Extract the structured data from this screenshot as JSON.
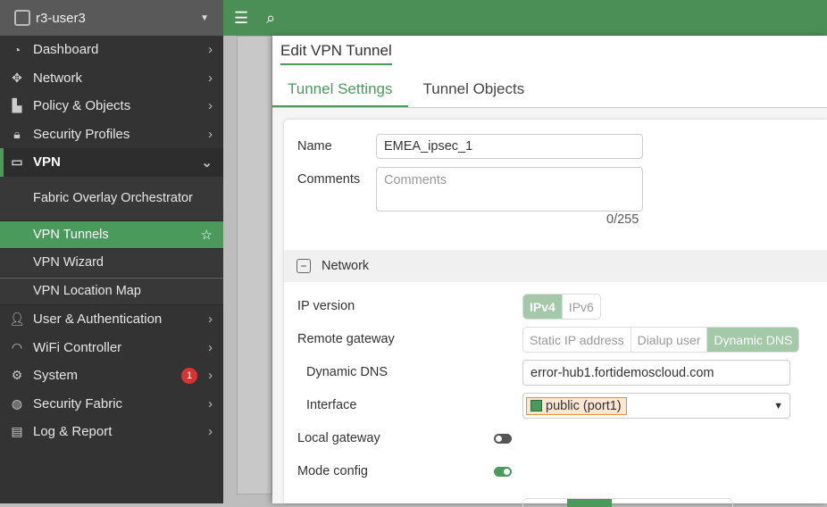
{
  "sidebar": {
    "device": "r3-user3",
    "items": [
      {
        "label": "Dashboard",
        "icon": "dashboard-icon"
      },
      {
        "label": "Network",
        "icon": "network-icon"
      },
      {
        "label": "Policy & Objects",
        "icon": "policy-icon"
      },
      {
        "label": "Security Profiles",
        "icon": "lock-icon"
      },
      {
        "label": "VPN",
        "icon": "laptop-icon"
      },
      {
        "label": "User & Authentication",
        "icon": "user-icon"
      },
      {
        "label": "WiFi Controller",
        "icon": "wifi-icon"
      },
      {
        "label": "System",
        "icon": "gear-icon",
        "badge": "1"
      },
      {
        "label": "Security Fabric",
        "icon": "fabric-icon"
      },
      {
        "label": "Log & Report",
        "icon": "chart-icon"
      }
    ],
    "vpn_sub": [
      "Fabric Overlay Orchestrator",
      "VPN Tunnels",
      "VPN Wizard",
      "VPN Location Map"
    ]
  },
  "modal": {
    "title": "Edit VPN Tunnel",
    "tabs": [
      "Tunnel Settings",
      "Tunnel Objects"
    ],
    "name_label": "Name",
    "name_value": "EMEA_ipsec_1",
    "comments_label": "Comments",
    "comments_placeholder": "Comments",
    "comments_count": "0/255",
    "section": "Network",
    "ip_version_label": "IP version",
    "ip_options": [
      "IPv4",
      "IPv6"
    ],
    "remote_gw_label": "Remote gateway",
    "remote_options": [
      "Static IP address",
      "Dialup user",
      "Dynamic DNS"
    ],
    "ddns_label": "Dynamic DNS",
    "ddns_value": "error-hub1.fortidemoscloud.com",
    "interface_label": "Interface",
    "interface_value": "public (port1)",
    "local_gw_label": "Local gateway",
    "local_gw_enabled": false,
    "mode_cfg_label": "Mode config",
    "mode_cfg_enabled": true
  },
  "colors": {
    "accent": "#4a9a5c",
    "topbar": "#4b8f57"
  }
}
